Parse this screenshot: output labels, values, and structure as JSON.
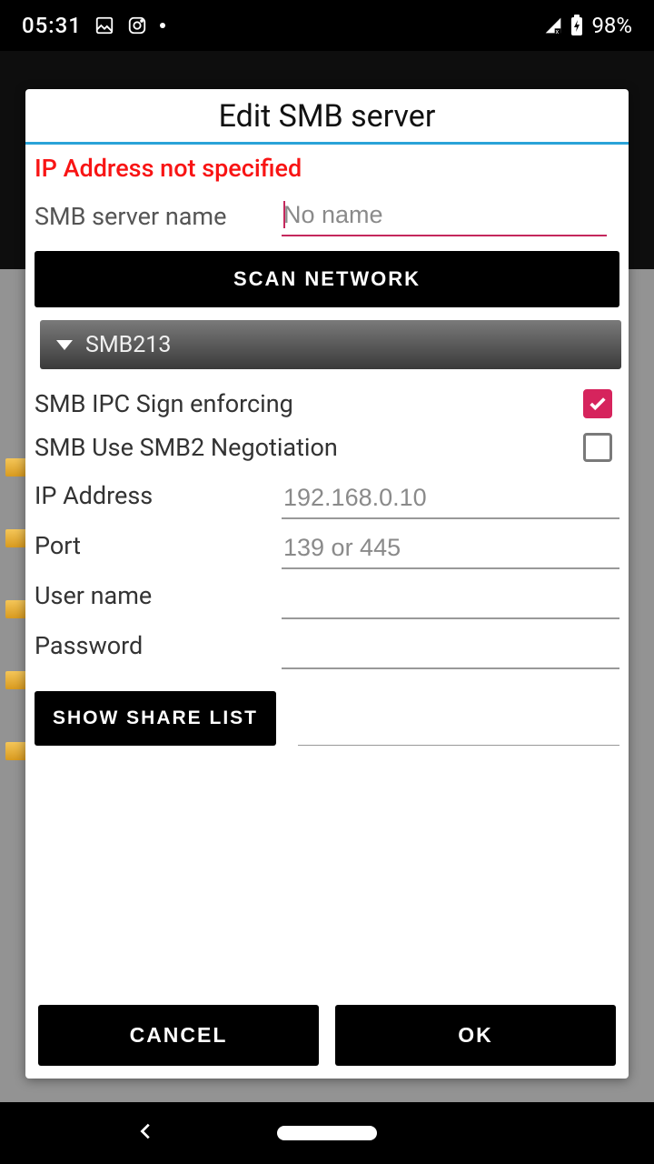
{
  "status": {
    "time": "05:31",
    "battery": "98%"
  },
  "dialog": {
    "title": "Edit SMB server",
    "error": "IP Address not specified",
    "name_label": "SMB server name",
    "name_placeholder": "No name",
    "scan_label": "SCAN NETWORK",
    "dropdown_value": "SMB213",
    "ipc_sign_label": "SMB IPC Sign enforcing",
    "ipc_sign_checked": true,
    "smb2_label": "SMB Use SMB2 Negotiation",
    "smb2_checked": false,
    "ip_label": "IP Address",
    "ip_placeholder": "192.168.0.10",
    "port_label": "Port",
    "port_placeholder": "139 or 445",
    "user_label": "User name",
    "pass_label": "Password",
    "share_btn": "SHOW SHARE LIST",
    "cancel": "CANCEL",
    "ok": "OK"
  }
}
